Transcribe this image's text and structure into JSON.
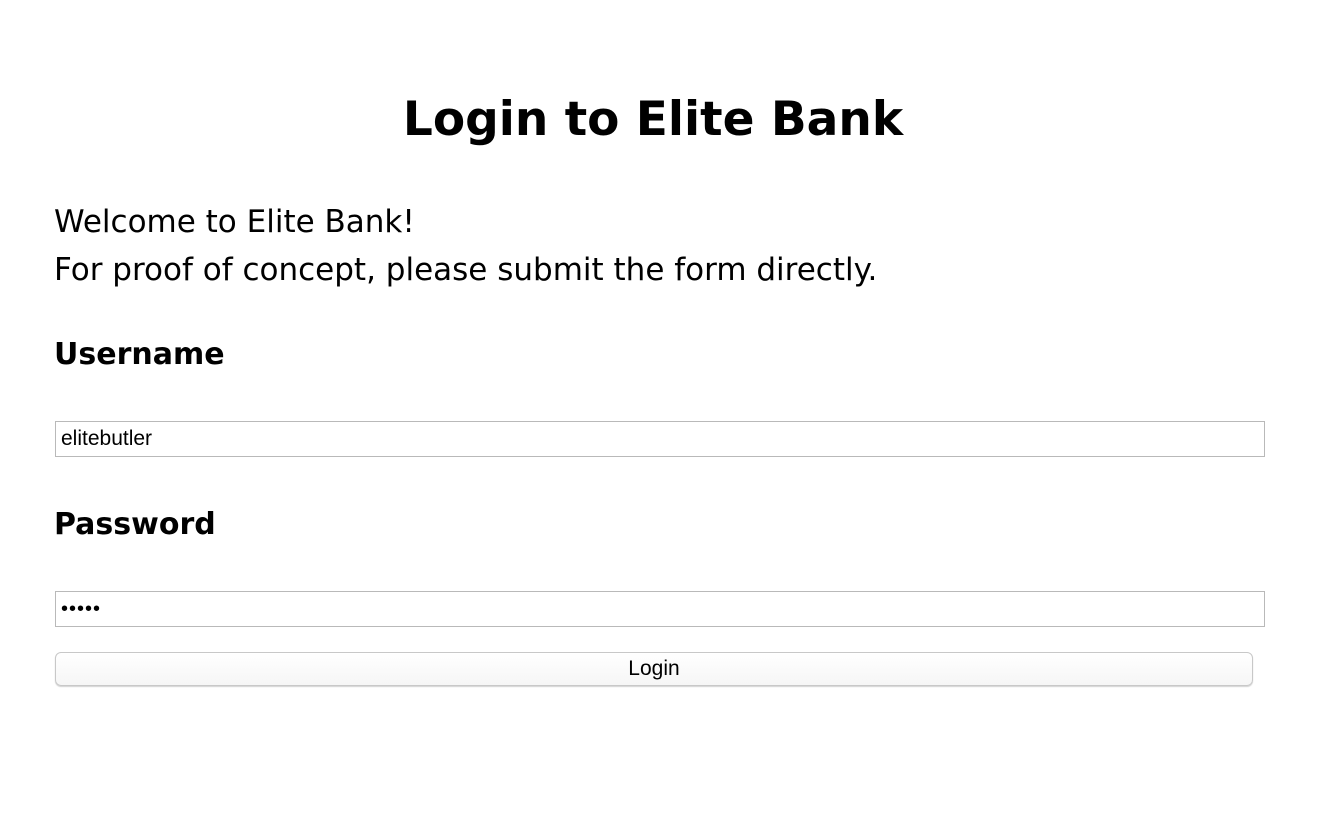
{
  "page": {
    "title": "Login to Elite Bank",
    "welcome_line1": "Welcome to Elite Bank!",
    "welcome_line2": "For proof of concept, please submit the form directly."
  },
  "form": {
    "username_label": "Username",
    "username_value": "elitebutler",
    "password_label": "Password",
    "password_value": "•••••",
    "login_label": "Login"
  }
}
